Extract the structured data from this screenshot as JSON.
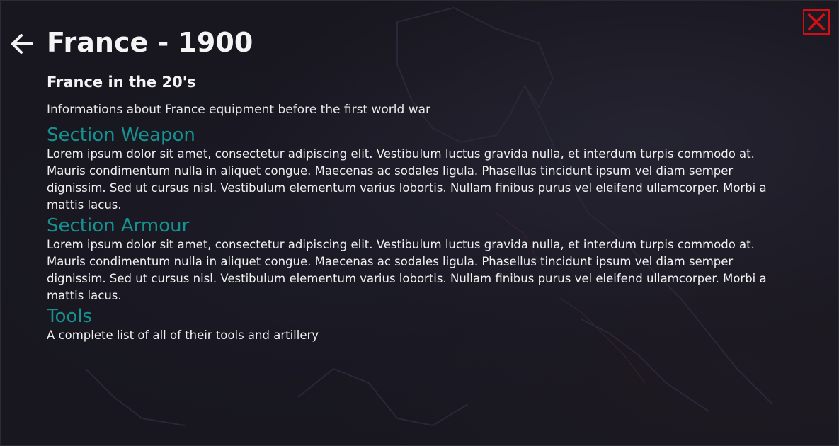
{
  "header": {
    "title": "France - 1900",
    "back_icon": "arrow-left-icon",
    "close_icon": "close-x-icon"
  },
  "colors": {
    "accent_teal": "#159190",
    "close_red": "#d10f16",
    "background": "#18171f",
    "text": "#f2f2f2"
  },
  "main": {
    "subtitle": "France in the 20's",
    "intro": "Informations about France equipment before the first world war",
    "sections": [
      {
        "heading": "Section Weapon",
        "body": "Lorem ipsum dolor sit amet, consectetur adipiscing elit. Vestibulum luctus gravida nulla, et interdum turpis commodo at. Mauris condimentum nulla in aliquet congue. Maecenas ac sodales ligula. Phasellus tincidunt ipsum vel diam semper dignissim. Sed ut cursus nisl. Vestibulum elementum varius lobortis. Nullam finibus purus vel eleifend ullamcorper. Morbi a mattis lacus."
      },
      {
        "heading": "Section Armour",
        "body": "Lorem ipsum dolor sit amet, consectetur adipiscing elit. Vestibulum luctus gravida nulla, et interdum turpis commodo at. Mauris condimentum nulla in aliquet congue. Maecenas ac sodales ligula. Phasellus tincidunt ipsum vel diam semper dignissim. Sed ut cursus nisl. Vestibulum elementum varius lobortis. Nullam finibus purus vel eleifend ullamcorper. Morbi a mattis lacus."
      },
      {
        "heading": "Tools",
        "body": "A complete list of all of their tools and artillery"
      }
    ]
  }
}
